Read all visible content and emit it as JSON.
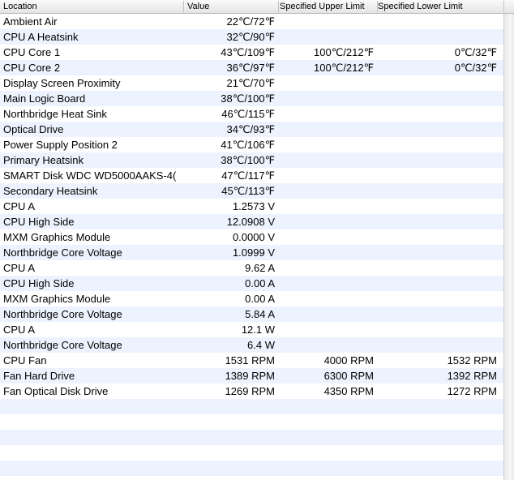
{
  "columns": [
    "Location",
    "Value",
    "Specified Upper Limit",
    "Specified Lower Limit"
  ],
  "rows": [
    [
      "Ambient Air",
      "22℃/72℉",
      "",
      ""
    ],
    [
      "CPU A Heatsink",
      "32℃/90℉",
      "",
      ""
    ],
    [
      "CPU Core 1",
      "43℃/109℉",
      "100℃/212℉",
      "0℃/32℉"
    ],
    [
      "CPU Core 2",
      "36℃/97℉",
      "100℃/212℉",
      "0℃/32℉"
    ],
    [
      "Display Screen Proximity",
      "21℃/70℉",
      "",
      ""
    ],
    [
      "Main Logic Board",
      "38℃/100℉",
      "",
      ""
    ],
    [
      "Northbridge Heat Sink",
      "46℃/115℉",
      "",
      ""
    ],
    [
      "Optical Drive",
      "34℃/93℉",
      "",
      ""
    ],
    [
      "Power Supply Position 2",
      "41℃/106℉",
      "",
      ""
    ],
    [
      "Primary Heatsink",
      "38℃/100℉",
      "",
      ""
    ],
    [
      "SMART Disk WDC WD5000AAKS-4(",
      "47℃/117℉",
      "",
      ""
    ],
    [
      "Secondary Heatsink",
      "45℃/113℉",
      "",
      ""
    ],
    [
      "CPU A",
      "1.2573 V",
      "",
      ""
    ],
    [
      "CPU High Side",
      "12.0908 V",
      "",
      ""
    ],
    [
      "MXM Graphics Module",
      "0.0000 V",
      "",
      ""
    ],
    [
      "Northbridge Core Voltage",
      "1.0999 V",
      "",
      ""
    ],
    [
      "CPU A",
      "9.62 A",
      "",
      ""
    ],
    [
      "CPU High Side",
      "0.00 A",
      "",
      ""
    ],
    [
      "MXM Graphics Module",
      "0.00 A",
      "",
      ""
    ],
    [
      "Northbridge Core Voltage",
      "5.84 A",
      "",
      ""
    ],
    [
      "CPU A",
      "12.1 W",
      "",
      ""
    ],
    [
      "Northbridge Core Voltage",
      "6.4 W",
      "",
      ""
    ],
    [
      "CPU Fan",
      "1531 RPM",
      "4000 RPM",
      "1532 RPM"
    ],
    [
      "Fan Hard Drive",
      "1389 RPM",
      "6300 RPM",
      "1392 RPM"
    ],
    [
      "Fan Optical Disk Drive",
      "1269 RPM",
      "4350 RPM",
      "1272 RPM"
    ]
  ],
  "colors": {
    "stripe": "#edf3fe",
    "header_bg": "#e8e8e8",
    "grid_line": "#c2c2c2"
  }
}
